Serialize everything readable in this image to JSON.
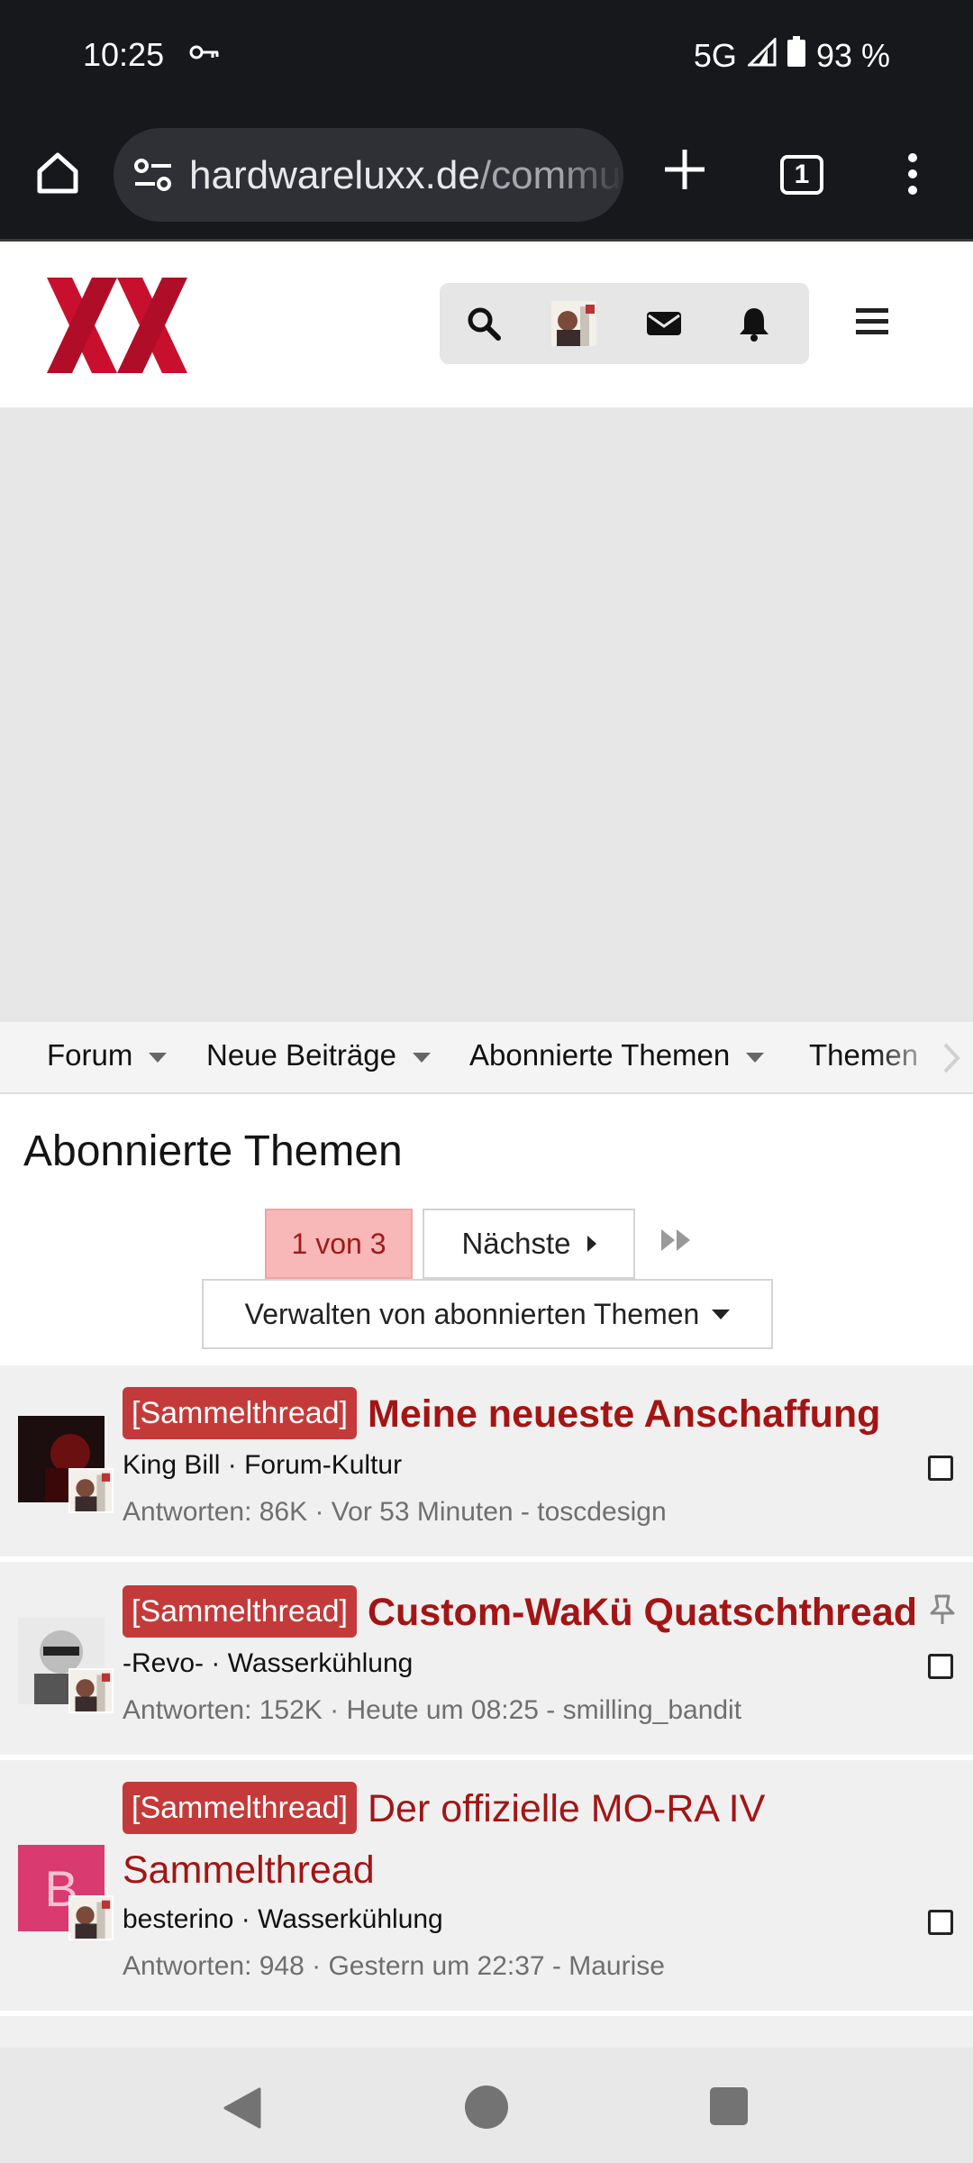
{
  "status_bar": {
    "time": "10:25",
    "network": "5G",
    "battery": "93 %"
  },
  "browser": {
    "url_host": "hardwareluxx.de",
    "url_path": "/commu",
    "tab_count": "1"
  },
  "site": {
    "logo_alt": "XX"
  },
  "nav": {
    "items": [
      {
        "label": "Forum"
      },
      {
        "label": "Neue Beiträge"
      },
      {
        "label": "Abonnierte Themen"
      },
      {
        "label": "Themen"
      }
    ]
  },
  "page": {
    "title": "Abonnierte Themen",
    "pagination": {
      "current": "1 von 3",
      "next": "Nächste"
    },
    "manage_label": "Verwalten von abonnierten Themen"
  },
  "threads": [
    {
      "prefix": "[Sammelthread]",
      "title": "Meine neueste Anschaffung",
      "author": "King Bill",
      "forum": "Forum-Kultur",
      "replies": "Antworten: 86K",
      "last": "Vor 53 Minuten - toscdesign",
      "pinned": false
    },
    {
      "prefix": "[Sammelthread]",
      "title": "Custom-WaKü Quatschthread",
      "author": "-Revo-",
      "forum": "Wasserkühlung",
      "replies": "Antworten: 152K",
      "last": "Heute um 08:25 - smilling_bandit",
      "pinned": true
    },
    {
      "prefix": "[Sammelthread]",
      "title": "Der offizielle MO-RA IV Sammelthread",
      "author": "besterino",
      "forum": "Wasserkühlung",
      "replies": "Antworten: 948",
      "last": "Gestern um 22:37 - Maurise",
      "avatar_letter": "B",
      "avatar_color": "#d93a6f",
      "pinned": false
    }
  ],
  "colors": {
    "accent": "#a31515",
    "prefix_bg": "#c43a3a",
    "page_current_bg": "#f8b8b8"
  }
}
